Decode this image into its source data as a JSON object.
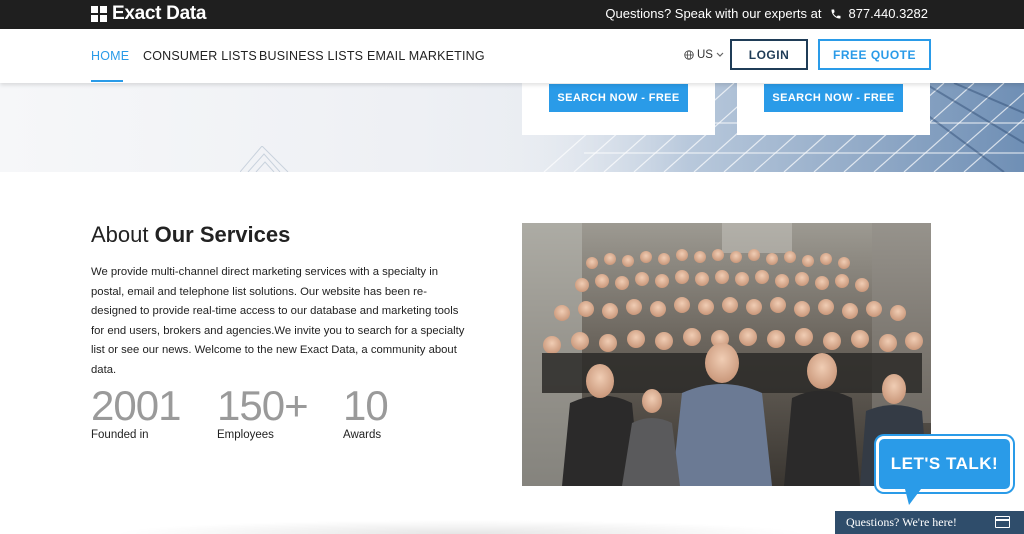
{
  "brand": {
    "name": "Exact Data"
  },
  "topbar": {
    "questions_text": "Questions? Speak with our experts at",
    "phone": "877.440.3282"
  },
  "nav": {
    "items": [
      {
        "label": "HOME",
        "active": true
      },
      {
        "label": "CONSUMER LISTS",
        "active": false
      },
      {
        "label": "BUSINESS LISTS",
        "active": false
      },
      {
        "label": "EMAIL MARKETING",
        "active": false
      }
    ],
    "language": "US",
    "login_label": "LOGIN",
    "quote_label": "FREE QUOTE"
  },
  "hero": {
    "search_buttons": [
      "SEARCH NOW - FREE",
      "SEARCH NOW - FREE"
    ]
  },
  "about": {
    "title_plain": "About ",
    "title_bold": "Our Services",
    "paragraph": "We provide multi-channel direct marketing services with a specialty in postal, email and telephone list solutions. Our website has been re-designed to provide real-time access to our database and marketing tools for end users, brokers and agencies.We invite you to search for a specialty list or see our news. Welcome to the new Exact Data, a community about data.",
    "stats": [
      {
        "value": "2001",
        "label": "Founded in"
      },
      {
        "value": "150+",
        "label": "Employees"
      },
      {
        "value": "10",
        "label": "Awards"
      }
    ]
  },
  "chat": {
    "bubble_text": "LET'S TALK!",
    "bar_text": "Questions? We're here!"
  },
  "colors": {
    "accent": "#2a9be8",
    "dark_navy": "#1f3c57",
    "topbar": "#1f1f1f",
    "chat_bar": "#2f4d6b"
  },
  "icons": {
    "phone": "phone-icon",
    "globe": "globe-icon",
    "chat": "chat-window-icon",
    "chevron": "chevron-down-icon"
  }
}
